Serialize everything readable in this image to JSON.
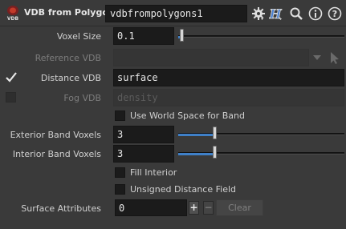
{
  "header": {
    "icon_text": "VDB",
    "node_type": "VDB from Polygons",
    "node_name": "vdbfrompolygons1",
    "icons": [
      "gear-icon",
      "help-h-icon",
      "search-icon",
      "info-icon",
      "help-question-icon"
    ]
  },
  "params": {
    "voxel_size": {
      "label": "Voxel Size",
      "value": "0.1",
      "slider_fraction": 0.02
    },
    "reference_vdb": {
      "label": "Reference VDB",
      "value": ""
    },
    "distance_vdb": {
      "label": "Distance VDB",
      "value": "surface",
      "checked": true
    },
    "fog_vdb": {
      "label": "Fog VDB",
      "value": "density",
      "checked": false
    },
    "use_world_space": {
      "label": "Use World Space for Band",
      "checked": false
    },
    "exterior_band": {
      "label": "Exterior Band Voxels",
      "value": "3",
      "slider_fraction": 0.3
    },
    "interior_band": {
      "label": "Interior Band Voxels",
      "value": "3",
      "slider_fraction": 0.3
    },
    "fill_interior": {
      "label": "Fill Interior",
      "checked": false
    },
    "unsigned_distance": {
      "label": "Unsigned Distance Field",
      "checked": false
    },
    "surface_attributes": {
      "label": "Surface Attributes",
      "value": "0",
      "add_label": "+",
      "remove_label": "−",
      "clear_label": "Clear"
    }
  },
  "colors": {
    "accent": "#3f80c8",
    "background": "#3a3a3a",
    "field": "#1b1b1b"
  }
}
